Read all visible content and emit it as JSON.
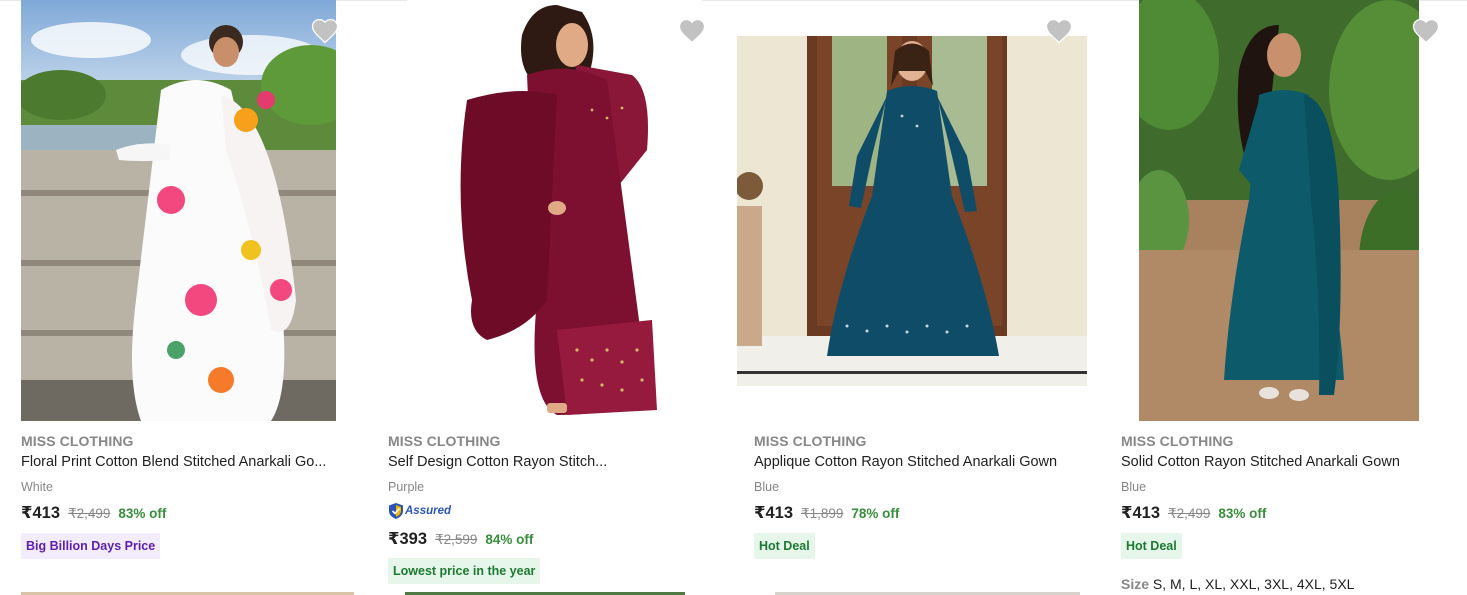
{
  "products": [
    {
      "brand": "MISS CLOTHING",
      "title": "Floral Print Cotton Blend Stitched Anarkali Go...",
      "color": "White",
      "price": "₹413",
      "mrp": "₹2,499",
      "discount": "83% off",
      "tag": "Big Billion Days Price",
      "image": "woman-in-white-floral-anarkali-gown"
    },
    {
      "brand": "MISS CLOTHING",
      "title": "Self Design Cotton Rayon Stitch...",
      "color": "Purple",
      "assured": "Assured",
      "price": "₹393",
      "mrp": "₹2,599",
      "discount": "84% off",
      "tag": "Lowest price in the year",
      "image": "woman-in-maroon-anarkali-gown"
    },
    {
      "brand": "MISS CLOTHING",
      "title": "Applique Cotton Rayon Stitched Anarkali Gown",
      "color": "Blue",
      "price": "₹413",
      "mrp": "₹1,899",
      "discount": "78% off",
      "tag": "Hot Deal",
      "image": "woman-in-teal-anarkali-gown-at-door"
    },
    {
      "brand": "MISS CLOTHING",
      "title": "Solid Cotton Rayon Stitched Anarkali Gown",
      "color": "Blue",
      "price": "₹413",
      "mrp": "₹2,499",
      "discount": "83% off",
      "tag": "Hot Deal",
      "sizes_label": "Size",
      "sizes": "S, M, L, XL, XXL, 3XL, 4XL, 5XL",
      "image": "woman-in-teal-anarkali-gown-in-garden"
    }
  ],
  "icons": {
    "wishlist": "heart-icon",
    "assured": "shield-check-icon"
  },
  "colors": {
    "discount": "#388e3c",
    "bbd_tag_text": "#5c1fae",
    "hot_deal_text": "#1c7a32",
    "assured_blue": "#2a55b8",
    "wishlist_grey": "#c2c2c2"
  }
}
